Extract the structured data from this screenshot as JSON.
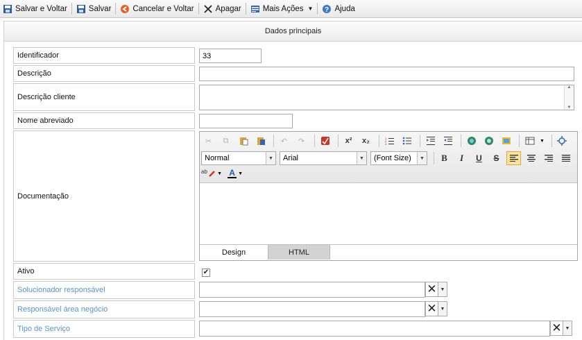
{
  "toolbar": {
    "save_back": "Salvar e Voltar",
    "save": "Salvar",
    "cancel_back": "Cancelar e Voltar",
    "delete": "Apagar",
    "more_actions": "Mais Ações",
    "help": "Ajuda"
  },
  "section": {
    "title": "Dados principais"
  },
  "fields": {
    "identificador": {
      "label": "Identificador",
      "value": "33"
    },
    "descricao": {
      "label": "Descrição",
      "value": ""
    },
    "descricao_cliente": {
      "label": "Descrição cliente",
      "value": ""
    },
    "nome_abreviado": {
      "label": "Nome abreviado",
      "value": ""
    },
    "documentacao": {
      "label": "Documentação"
    },
    "ativo": {
      "label": "Ativo",
      "checked": true,
      "check_glyph": "✔"
    },
    "solucionador": {
      "label": "Solucionador responsável",
      "value": ""
    },
    "responsavel_area": {
      "label": "Responsável área negócio",
      "value": ""
    },
    "tipo_servico": {
      "label": "Tipo de Serviço",
      "value": ""
    }
  },
  "editor": {
    "format_value": "Normal",
    "font_value": "Arial",
    "size_value": "(Font Size)",
    "tabs": [
      "Design",
      "HTML"
    ],
    "active_tab": "Design",
    "superscript": "x²",
    "subscript": "x₂",
    "bold": "B",
    "italic": "I",
    "underline": "U",
    "strike": "S",
    "font_color": "A",
    "spell": "ab"
  },
  "colors": {
    "link_label": "#5b93c9",
    "active_button_bg": "#fbe4a0"
  }
}
